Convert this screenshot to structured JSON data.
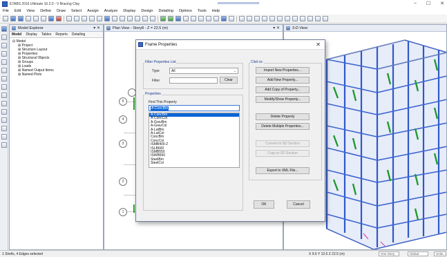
{
  "window": {
    "title": "ETABS 2016 Ultimate 16.2.0 - V Bracing Clay",
    "controls": [
      "–",
      "☐",
      "✕"
    ]
  },
  "menu": [
    "File",
    "Edit",
    "View",
    "Define",
    "Draw",
    "Select",
    "Assign",
    "Analyze",
    "Display",
    "Design",
    "Detailing",
    "Options",
    "Tools",
    "Help"
  ],
  "explorer": {
    "title": "Model Explorer",
    "tabs": [
      "Model",
      "Display",
      "Tables",
      "Reports",
      "Detailing"
    ],
    "tree_root": "Model",
    "tree_items": [
      "Project",
      "Structure Layout",
      "Properties",
      "Structural Objects",
      "Groups",
      "Loads",
      "Named Output Items",
      "Named Plots"
    ]
  },
  "plan_view": {
    "title": "Plan View - Story8 - Z = 22.5 (m)",
    "bubbles": [
      "5",
      "4",
      "3",
      "2",
      "1"
    ]
  },
  "view3d": {
    "title": "3-D View"
  },
  "dialog": {
    "title": "Frame Properties",
    "filter_group": "Filter Properties List",
    "type_label": "Type",
    "type_value": "All",
    "filter_label": "Filter",
    "filter_value": "",
    "clear_label": "Clear",
    "properties_group": "Properties",
    "find_label": "Find This Property",
    "find_value": "A-ConcBm",
    "properties": [
      "A-ConcBm",
      "A-ConcCol",
      "A-GravBm",
      "A-GravCol",
      "A-LatBm",
      "A-LatCol",
      "ConcBm",
      "ConcCol",
      "ISMB400-2",
      "ISLB600",
      "ISMB550",
      "ISWB550",
      "SteelBm",
      "SteelCol"
    ],
    "selected_index": 0,
    "click_group": "Click to:",
    "buttons": {
      "import": "Import New Properties...",
      "add": "Add New Property...",
      "copy": "Add Copy of Property...",
      "modify": "Modify/Show Property...",
      "delete": "Delete Property",
      "delete_multiple": "Delete Multiple Properties...",
      "convert_sd": "Convert to SD Section",
      "copy_sd": "Copy to SD Section",
      "export": "Export to XML File...",
      "ok": "OK",
      "cancel": "Cancel"
    }
  },
  "status": {
    "selection": "1 Shells, 4 Edges selected",
    "coords": "X 9.6  Y 12.6  Z 22.5 (m)",
    "story": "One Story",
    "system": "Global",
    "units": "Units..."
  }
}
